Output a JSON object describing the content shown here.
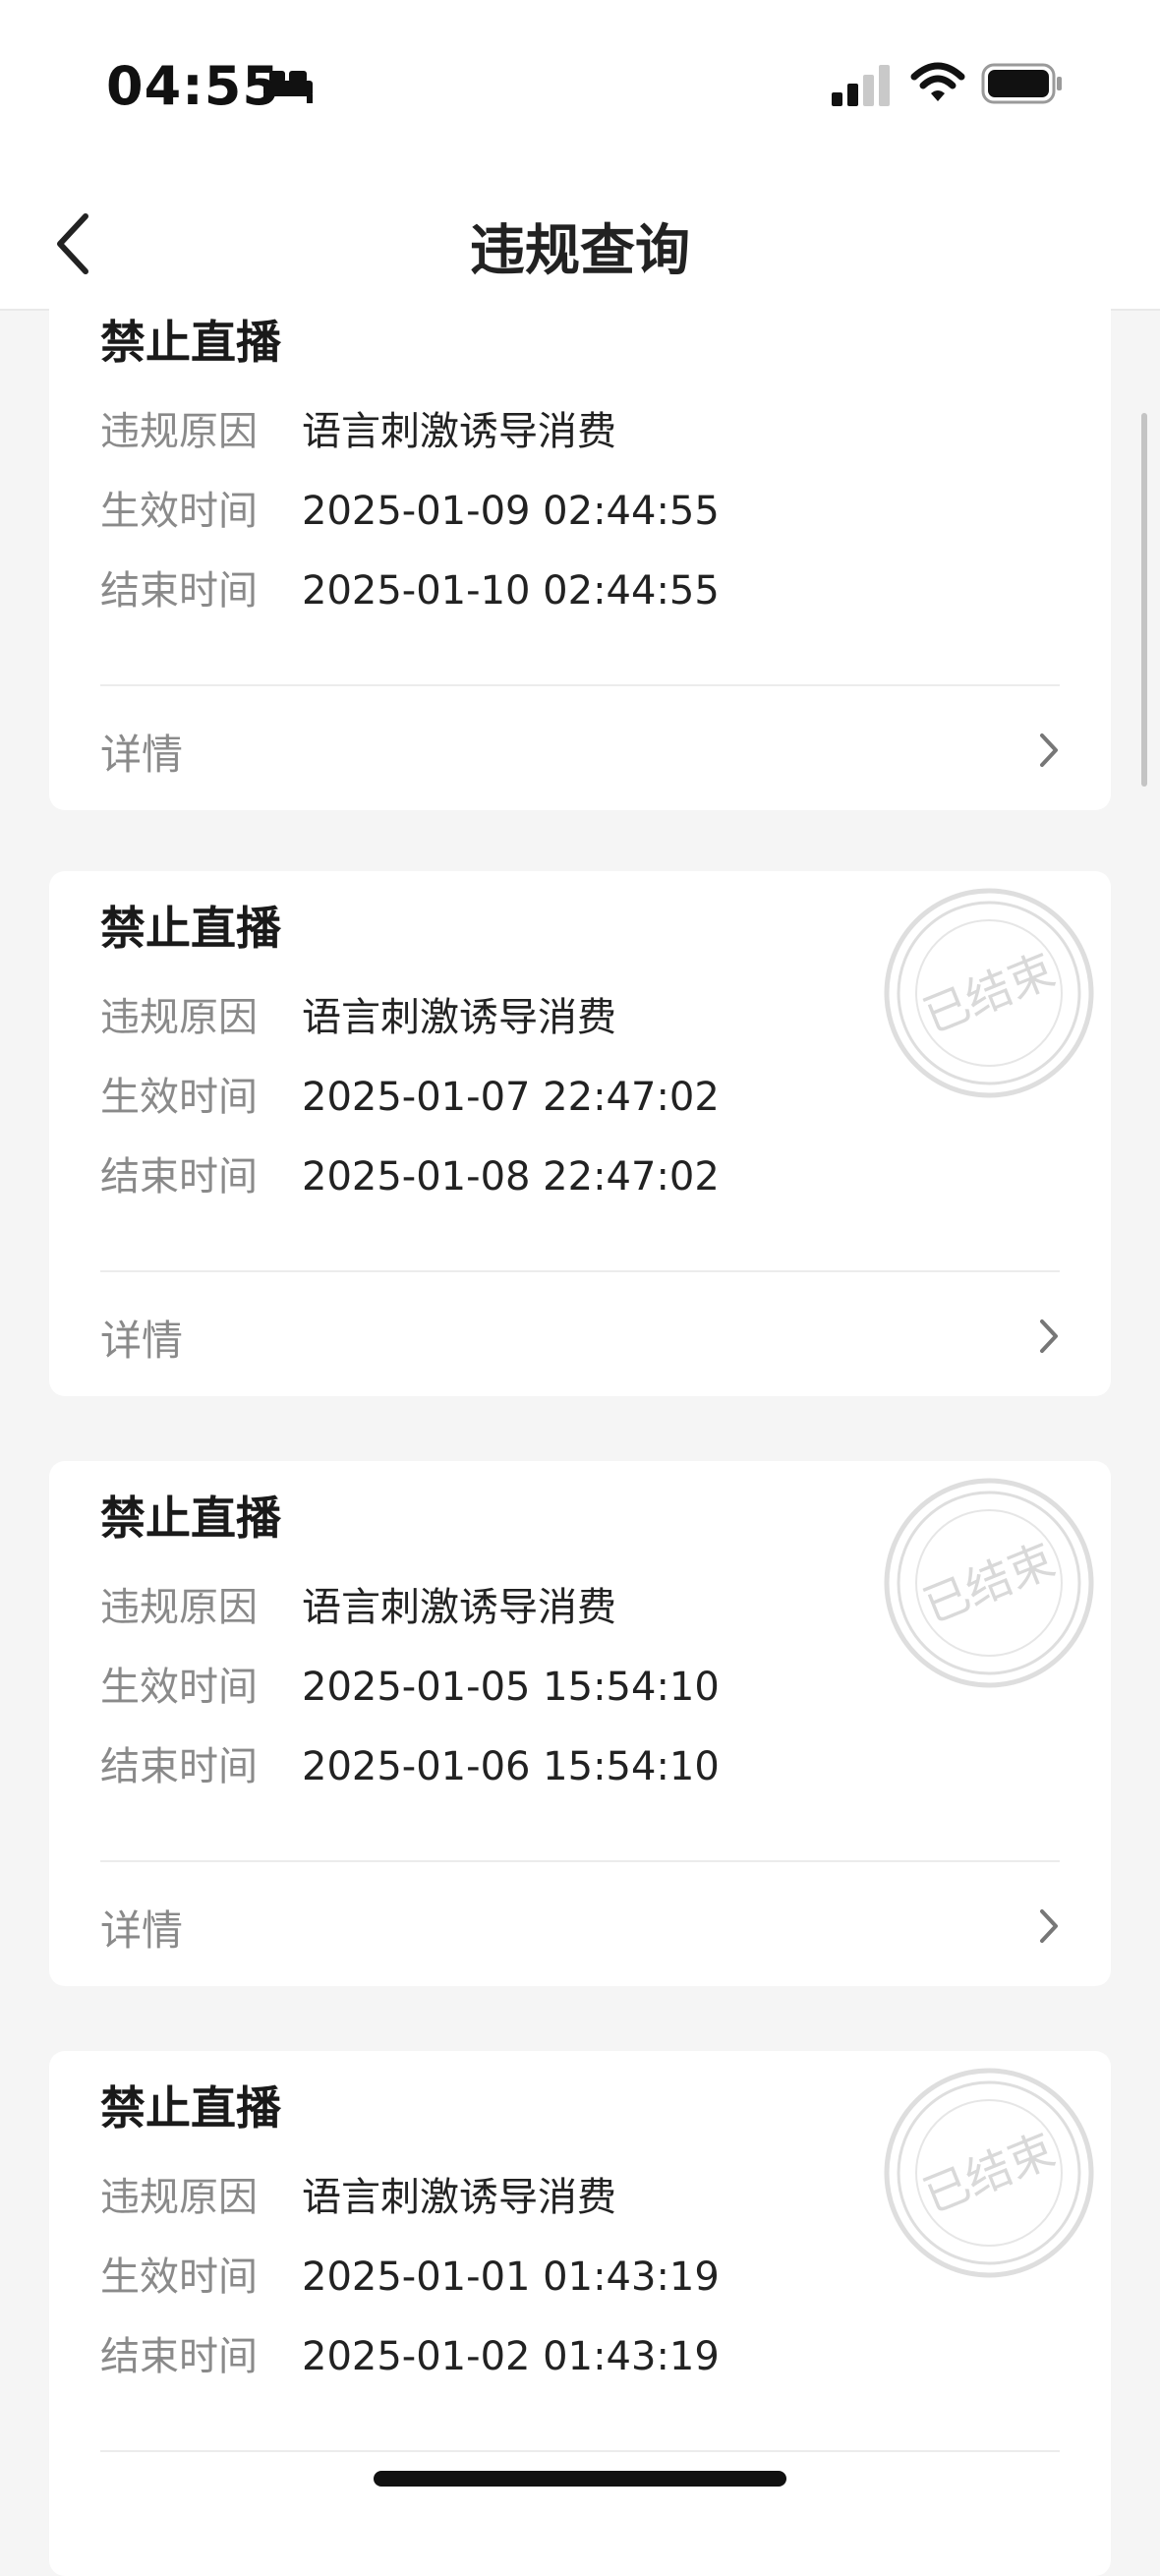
{
  "status_bar": {
    "time": "04:55"
  },
  "nav": {
    "title": "违规查询"
  },
  "labels": {
    "reason": "违规原因",
    "effective": "生效时间",
    "end": "结束时间",
    "details": "详情",
    "stamp": "已结束"
  },
  "records": [
    {
      "title": "禁止直播",
      "reason": "语言刺激诱导消费",
      "effective_time": "2025-01-09 02:44:55",
      "end_time": "2025-01-10 02:44:55",
      "ended": false
    },
    {
      "title": "禁止直播",
      "reason": "语言刺激诱导消费",
      "effective_time": "2025-01-07 22:47:02",
      "end_time": "2025-01-08 22:47:02",
      "ended": true
    },
    {
      "title": "禁止直播",
      "reason": "语言刺激诱导消费",
      "effective_time": "2025-01-05 15:54:10",
      "end_time": "2025-01-06 15:54:10",
      "ended": true
    },
    {
      "title": "禁止直播",
      "reason": "语言刺激诱导消费",
      "effective_time": "2025-01-01 01:43:19",
      "end_time": "2025-01-02 01:43:19",
      "ended": true
    }
  ]
}
